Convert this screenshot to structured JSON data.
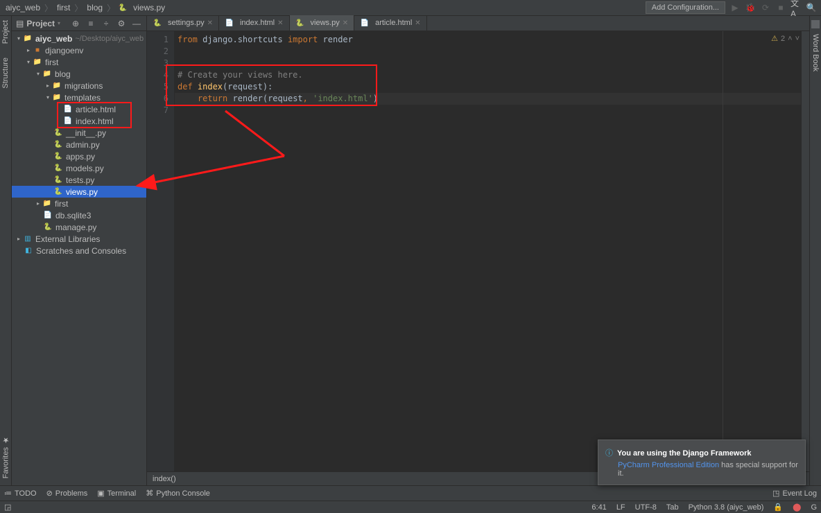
{
  "breadcrumb": {
    "root": "aiyc_web",
    "p1": "first",
    "p2": "blog",
    "file": "views.py"
  },
  "navbar": {
    "config": "Add Configuration..."
  },
  "left_rail": {
    "project": "Project",
    "structure": "Structure",
    "favorites": "Favorites"
  },
  "right_rail": {
    "wordbook": "Word Book"
  },
  "project_panel": {
    "title": "Project"
  },
  "tree": {
    "root": "aiyc_web",
    "root_hint": "~/Desktop/aiyc_web",
    "djangoenv": "djangoenv",
    "first": "first",
    "blog": "blog",
    "migrations": "migrations",
    "templates": "templates",
    "article": "article.html",
    "index": "index.html",
    "init": "__init__.py",
    "admin": "admin.py",
    "apps": "apps.py",
    "models": "models.py",
    "tests": "tests.py",
    "views": "views.py",
    "first2": "first",
    "db": "db.sqlite3",
    "manage": "manage.py",
    "ext": "External Libraries",
    "scratch": "Scratches and Consoles"
  },
  "tabs": [
    {
      "label": "settings.py"
    },
    {
      "label": "index.html"
    },
    {
      "label": "views.py",
      "active": true
    },
    {
      "label": "article.html"
    }
  ],
  "code": {
    "l1_a": "from",
    "l1_b": " django.shortcuts ",
    "l1_c": "import",
    "l1_d": " render",
    "l4": "# Create your views here.",
    "l5_a": "def ",
    "l5_b": "index",
    "l5_c": "(request):",
    "l6_a": "    return ",
    "l6_b": "render",
    "l6_c": "(request",
    "l6_d": ", ",
    "l6_e": "'index.html'",
    "l6_f": ")"
  },
  "inspections": {
    "count": "2"
  },
  "editor_bc": "index()",
  "tool_windows": {
    "todo": "TODO",
    "problems": "Problems",
    "terminal": "Terminal",
    "pyconsole": "Python Console"
  },
  "event_log": "Event Log",
  "status": {
    "pos": "6:41",
    "le": "LF",
    "enc": "UTF-8",
    "indent": "Tab",
    "interp": "Python 3.8 (aiyc_web)"
  },
  "popup": {
    "title": "You are using the Django Framework",
    "link": "PyCharm Professional Edition",
    "rest": " has special support for it."
  }
}
